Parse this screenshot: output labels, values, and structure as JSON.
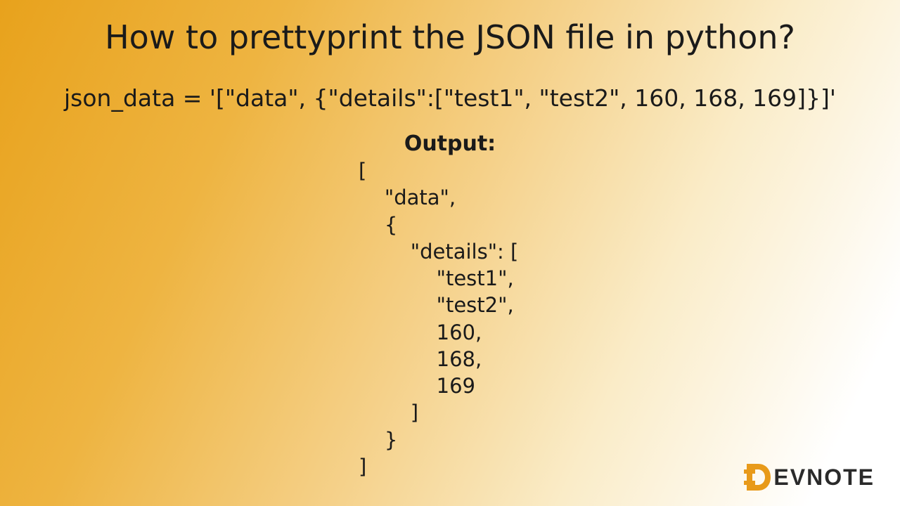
{
  "title": "How to prettyprint the JSON file in python?",
  "code_line": "json_data = '[\"data\", {\"details\":[\"test1\", \"test2\", 160, 168, 169]}]'",
  "output_label": "Output:",
  "output_text": "[\n    \"data\",\n    {\n        \"details\": [\n            \"test1\",\n            \"test2\",\n            160,\n            168,\n            169\n        ]\n    }\n]",
  "logo": {
    "text": "EVNOTE"
  }
}
